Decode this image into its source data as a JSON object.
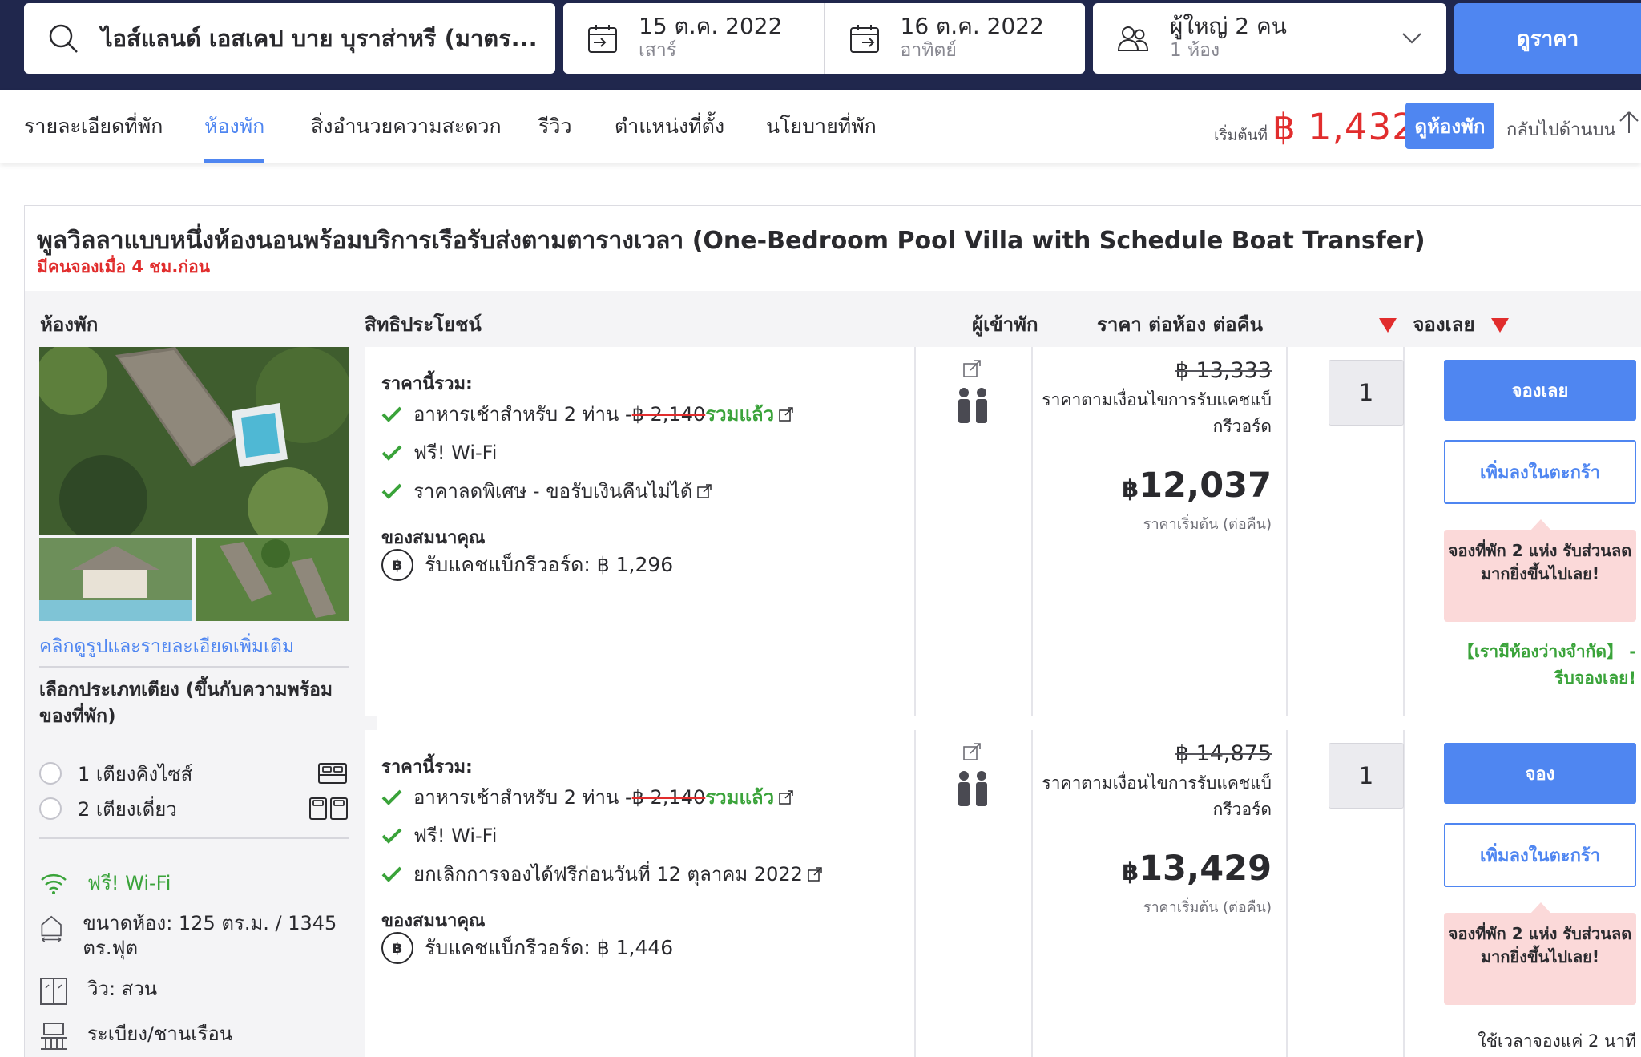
{
  "search": {
    "destination": "ไอส์แลนด์ เอสเคป บาย บุราส่าหรี (มาตร...",
    "checkin": {
      "date": "15 ต.ค. 2022",
      "day": "เสาร์"
    },
    "checkout": {
      "date": "16 ต.ค. 2022",
      "day": "อาทิตย์"
    },
    "guests": {
      "adults": "ผู้ใหญ่ 2 คน",
      "rooms": "1 ห้อง"
    },
    "button_label": "ดูราคา"
  },
  "nav": {
    "tabs": [
      {
        "label": "รายละเอียดที่พัก"
      },
      {
        "label": "ห้องพัก"
      },
      {
        "label": "สิ่งอำนวยความสะดวก"
      },
      {
        "label": "รีวิว"
      },
      {
        "label": "ตำแหน่งที่ตั้ง"
      },
      {
        "label": "นโยบายที่พัก"
      }
    ],
    "active_tab": "ห้องพัก",
    "start_label": "เริ่มต้นที่",
    "start_price": "฿ 1,432",
    "view_rooms_label": "ดูห้องพัก",
    "back_to_top_label": "กลับไปด้านบน"
  },
  "room": {
    "title": "พูลวิลลาแบบหนึ่งห้องนอนพร้อมบริการเรือรับส่งตามตารางเวลา (One-Bedroom Pool Villa with Schedule Boat Transfer)",
    "booked_ago": "มีคนจองเมื่อ 4 ชม.ก่อน",
    "headers": {
      "room": "ห้องพัก",
      "benefits": "สิทธิประโยชน์",
      "occupancy": "ผู้เข้าพัก",
      "price": "ราคา ต่อห้อง ต่อคืน",
      "book": "จองเลย"
    },
    "photo_link": "คลิกดูรูปและรายละเอียดเพิ่มเติม",
    "bed_title": "เลือกประเภทเตียง (ขึ้นกับความพร้อมของที่พัก)",
    "bed_options": [
      {
        "label": "1 เตียงคิงไซส์",
        "icon": "king-bed-icon"
      },
      {
        "label": "2 เตียงเดี่ยว",
        "icon": "twin-bed-icon"
      }
    ],
    "amenities": [
      {
        "label": "ฟรี! Wi-Fi",
        "icon": "wifi-icon"
      },
      {
        "label": "ขนาดห้อง: 125 ตร.ม. / 1345 ตร.ฟุต",
        "icon": "room-size-icon"
      },
      {
        "label": "วิว: สวน",
        "icon": "window-view-icon"
      },
      {
        "label": "ระเบียง/ชานเรือน",
        "icon": "balcony-icon"
      }
    ],
    "offers": [
      {
        "includes_title": "ราคานี้รวม:",
        "benefits": [
          {
            "text": "อาหารเช้าสำหรับ 2 ท่าน - ",
            "strike": "฿ 2,140",
            "included": " รวมแล้ว"
          },
          {
            "text": "ฟรี! Wi-Fi"
          },
          {
            "text": "ราคาลดพิเศษ - ขอรับเงินคืนไม่ได้"
          }
        ],
        "gift_title": "ของสมนาคุณ",
        "cashback": "รับแคชแบ็กรีวอร์ด: ฿ 1,296",
        "original_price": "฿ 13,333",
        "price_condition": "ราคาตามเงื่อนไขการรับแคชแบ็กรีวอร์ด",
        "price_currency": "฿",
        "price": "12,037",
        "price_sub": "ราคาเริ่มต้น (ต่อคืน)",
        "qty": "1",
        "book_label": "จองเลย",
        "cart_label": "เพิ่มลงในตะกร้า",
        "promo": "จองที่พัก 2 แห่ง รับส่วนลดมากยิ่งขึ้นไปเลย!",
        "note": "【เรามีห้องว่างจำกัด】 - รีบจองเลย!"
      },
      {
        "includes_title": "ราคานี้รวม:",
        "benefits": [
          {
            "text": "อาหารเช้าสำหรับ 2 ท่าน - ",
            "strike": "฿ 2,140",
            "included": " รวมแล้ว"
          },
          {
            "text": "ฟรี! Wi-Fi"
          },
          {
            "text": "ยกเลิกการจองได้ฟรีก่อนวันที่ 12 ตุลาคม 2022"
          }
        ],
        "gift_title": "ของสมนาคุณ",
        "cashback": "รับแคชแบ็กรีวอร์ด: ฿ 1,446",
        "original_price": "฿ 14,875",
        "price_condition": "ราคาตามเงื่อนไขการรับแคชแบ็กรีวอร์ด",
        "price_currency": "฿",
        "price": "13,429",
        "price_sub": "ราคาเริ่มต้น (ต่อคืน)",
        "qty": "1",
        "book_label": "จอง",
        "cart_label": "เพิ่มลงในตะกร้า",
        "promo": "จองที่พัก 2 แห่ง รับส่วนลดมากยิ่งขึ้นไปเลย!",
        "note": "ใช้เวลาจองแค่ 2 นาที"
      }
    ]
  },
  "colors": {
    "header_bg": "#20274d",
    "accent": "#4f86f1",
    "price_red": "#e12d2d",
    "success_green": "#3aa33a",
    "promo_bg": "#fbd9d9"
  }
}
